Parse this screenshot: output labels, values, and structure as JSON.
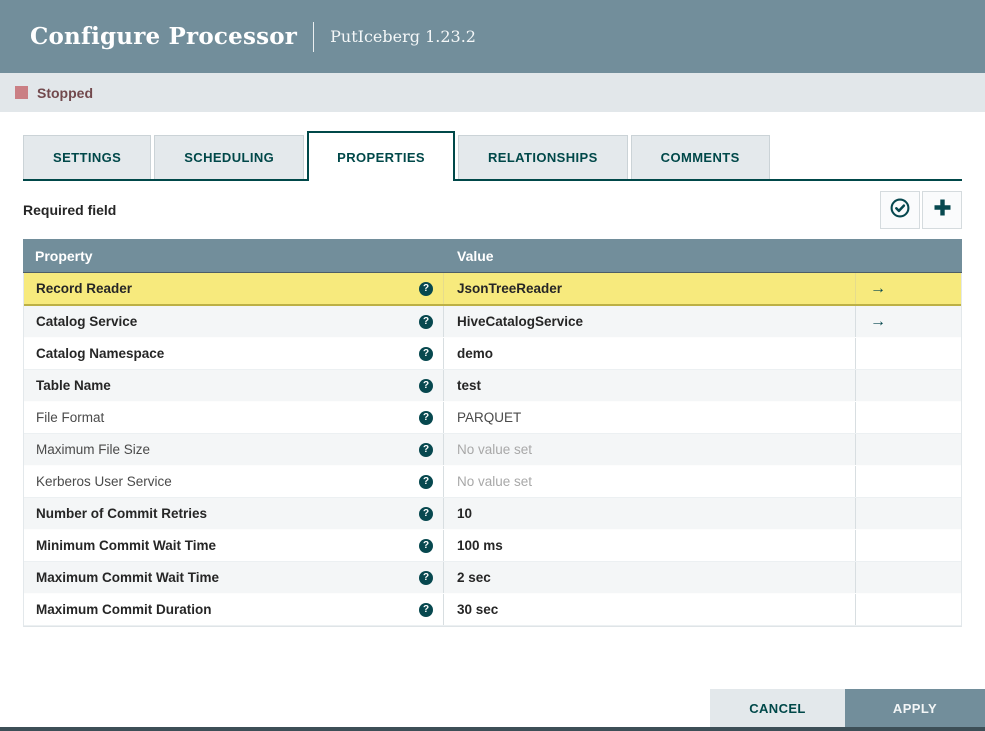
{
  "window": {
    "title": "Configure Processor",
    "subtitle": "PutIceberg 1.23.2"
  },
  "status": {
    "label": "Stopped"
  },
  "tabs": [
    {
      "label": "SETTINGS",
      "active": false
    },
    {
      "label": "SCHEDULING",
      "active": false
    },
    {
      "label": "PROPERTIES",
      "active": true
    },
    {
      "label": "RELATIONSHIPS",
      "active": false
    },
    {
      "label": "COMMENTS",
      "active": false
    }
  ],
  "toolbar": {
    "required_label": "Required field",
    "verify_button": "check-circle-icon",
    "add_button": "plus-icon"
  },
  "icons": {
    "help_glyph": "?",
    "goto_glyph": "→"
  },
  "table": {
    "columns": {
      "property": "Property",
      "value": "Value"
    },
    "rows": [
      {
        "property": "Record Reader",
        "value": "JsonTreeReader",
        "required": true,
        "value_set": true,
        "goto": true,
        "selected": true
      },
      {
        "property": "Catalog Service",
        "value": "HiveCatalogService",
        "required": true,
        "value_set": true,
        "goto": true,
        "selected": false
      },
      {
        "property": "Catalog Namespace",
        "value": "demo",
        "required": true,
        "value_set": true,
        "goto": false,
        "selected": false
      },
      {
        "property": "Table Name",
        "value": "test",
        "required": true,
        "value_set": true,
        "goto": false,
        "selected": false
      },
      {
        "property": "File Format",
        "value": "PARQUET",
        "required": false,
        "value_set": true,
        "goto": false,
        "selected": false
      },
      {
        "property": "Maximum File Size",
        "value": "No value set",
        "required": false,
        "value_set": false,
        "goto": false,
        "selected": false
      },
      {
        "property": "Kerberos User Service",
        "value": "No value set",
        "required": false,
        "value_set": false,
        "goto": false,
        "selected": false
      },
      {
        "property": "Number of Commit Retries",
        "value": "10",
        "required": true,
        "value_set": true,
        "goto": false,
        "selected": false
      },
      {
        "property": "Minimum Commit Wait Time",
        "value": "100 ms",
        "required": true,
        "value_set": true,
        "goto": false,
        "selected": false
      },
      {
        "property": "Maximum Commit Wait Time",
        "value": "2 sec",
        "required": true,
        "value_set": true,
        "goto": false,
        "selected": false
      },
      {
        "property": "Maximum Commit Duration",
        "value": "30 sec",
        "required": true,
        "value_set": true,
        "goto": false,
        "selected": false
      }
    ]
  },
  "footer": {
    "cancel_label": "CANCEL",
    "apply_label": "APPLY"
  },
  "colors": {
    "header_bg": "#728E9B",
    "accent": "#004849",
    "icon_teal": "#07484F",
    "status_bar_bg": "#E2E7EA",
    "stopped_red": "#CA7F84",
    "stopped_text": "#72494D",
    "selected_row_bg": "#F7EA7D",
    "row_alt_bg": "#F4F6F7",
    "table_header_bg": "#728E9B"
  }
}
